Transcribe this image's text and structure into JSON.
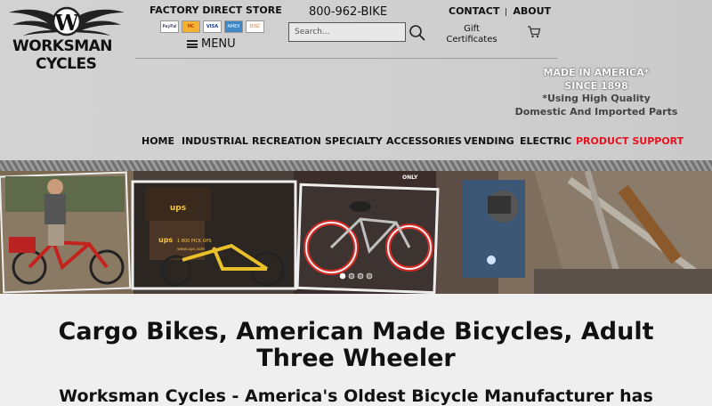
{
  "brand": {
    "logo_line1": "WORKSMAN",
    "logo_line2": "CYCLES"
  },
  "header": {
    "store_label": "FACTORY DIRECT STORE",
    "payment_methods": [
      "PayPal",
      "MC",
      "VISA",
      "AMEX",
      "DISC"
    ],
    "menu_label": "MENU",
    "phone": "800-962-BIKE",
    "search_placeholder": "Search...",
    "contact_label": "CONTACT",
    "about_label": "ABOUT",
    "gift_line1": "Gift",
    "gift_line2": "Certificates"
  },
  "tagline": {
    "line1": "MADE IN AMERICA*",
    "line2": "SINCE 1898",
    "line3": "*Using High Quality",
    "line4": "Domestic And Imported Parts"
  },
  "nav": {
    "items": [
      "HOME",
      "INDUSTRIAL",
      "RECREATION",
      "SPECIALTY",
      "ACCESSORIES",
      "VENDING",
      "ELECTRIC",
      "PRODUCT SUPPORT"
    ],
    "highlight_color": "#e8121f"
  },
  "hero": {
    "box_text": "1 800 PICK UPS",
    "box_url": "www.ups.com",
    "brand_mark": "ups",
    "sign_text": "ONLY",
    "slide_count": 4,
    "active_slide": 1
  },
  "main": {
    "title": "Cargo Bikes, American Made Bicycles, Adult Three Wheeler",
    "subtitle": "Worksman Cycles - America's Oldest Bicycle Manufacturer has"
  }
}
